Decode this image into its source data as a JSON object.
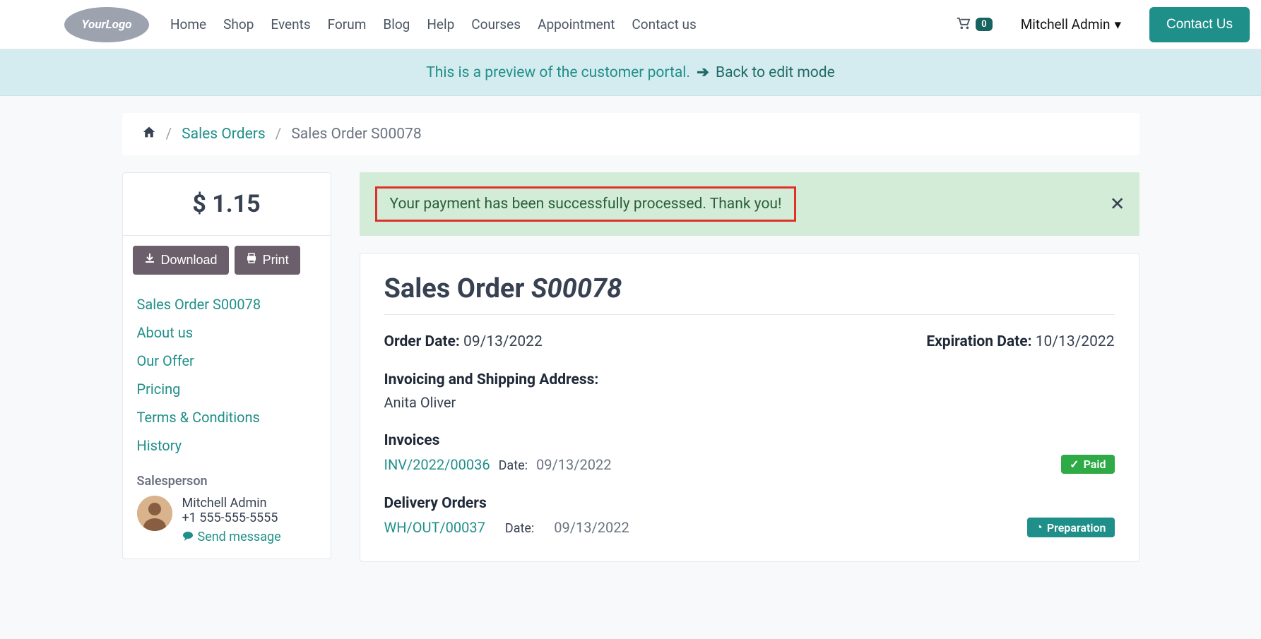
{
  "header": {
    "logo_text": "YourLogo",
    "nav": [
      "Home",
      "Shop",
      "Events",
      "Forum",
      "Blog",
      "Help",
      "Courses",
      "Appointment",
      "Contact us"
    ],
    "cart_count": "0",
    "user": "Mitchell Admin",
    "contact_btn": "Contact Us"
  },
  "preview_banner": {
    "text": "This is a preview of the customer portal. ",
    "link": "Back to edit mode"
  },
  "breadcrumb": {
    "home": "",
    "level1": "Sales Orders",
    "current": "Sales Order S00078"
  },
  "sidebar": {
    "price": "$ 1.15",
    "download": "Download",
    "print": "Print",
    "links": [
      "Sales Order S00078",
      "About us",
      "Our Offer",
      "Pricing",
      "Terms & Conditions",
      "History"
    ],
    "salesperson_label": "Salesperson",
    "salesperson_name": "Mitchell Admin",
    "salesperson_phone": "+1 555-555-5555",
    "send_message": "Send message"
  },
  "alert": {
    "text": "Your payment has been successfully processed. Thank you!"
  },
  "order": {
    "title_prefix": "Sales Order ",
    "title_num": "S00078",
    "order_date_label": "Order Date:",
    "order_date": "09/13/2022",
    "exp_label": "Expiration Date:",
    "exp_date": "10/13/2022",
    "addr_label": "Invoicing and Shipping Address:",
    "addr_name": "Anita Oliver",
    "invoices_label": "Invoices",
    "invoice_ref": "INV/2022/00036",
    "invoice_date_label": "Date:",
    "invoice_date": "09/13/2022",
    "paid_badge": "Paid",
    "delivery_label": "Delivery Orders",
    "delivery_ref": "WH/OUT/00037",
    "delivery_date_label": "Date:",
    "delivery_date": "09/13/2022",
    "prep_badge": "Preparation"
  }
}
